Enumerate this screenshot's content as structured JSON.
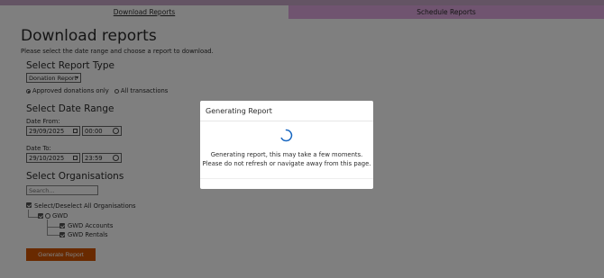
{
  "tabs": {
    "download_label": "Download Reports",
    "schedule_label": "Schedule Reports"
  },
  "page": {
    "title": "Download reports",
    "subtitle": "Please select the date range and choose a report to download."
  },
  "report_type": {
    "heading": "Select Report Type",
    "selected": "Donation Report",
    "radio_approved": "Approved donations only",
    "radio_all": "All transactions",
    "radio_selected": "approved"
  },
  "date_range": {
    "heading": "Select Date Range",
    "from_label": "Date From:",
    "from_date": "29/09/2025",
    "from_time": "00:00",
    "to_label": "Date To:",
    "to_date": "29/10/2025",
    "to_time": "23:59"
  },
  "organisations": {
    "heading": "Select Organisations",
    "search_placeholder": "Search...",
    "select_all_label": "Select/Deselect All Organisations",
    "root": "GWD",
    "children": [
      "GWD Accounts",
      "GWD Rentals"
    ]
  },
  "generate_button": "Generate Report",
  "modal": {
    "title": "Generating Report",
    "line1": "Generating report, this may take a few moments.",
    "line2": "Please do not refresh or navigate away from this page."
  },
  "colors": {
    "accent": "#d35400",
    "tab_active_bg": "#e0a9e0",
    "spinner": "#1565c0"
  },
  "icons": [
    "calendar-icon",
    "clock-icon",
    "checkbox-icon",
    "spinner-icon",
    "chevron-down-icon"
  ]
}
